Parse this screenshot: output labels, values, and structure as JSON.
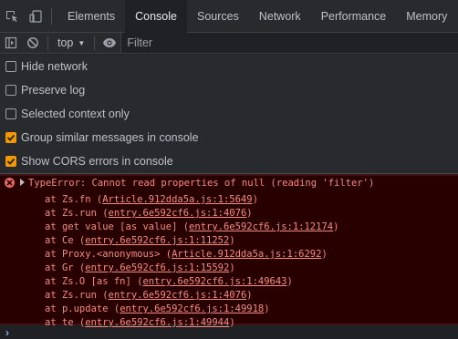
{
  "tabbar": {
    "icons": [
      "inspect-element-icon",
      "device-toolbar-icon"
    ],
    "tabs": [
      {
        "label": "Elements",
        "active": false
      },
      {
        "label": "Console",
        "active": true
      },
      {
        "label": "Sources",
        "active": false
      },
      {
        "label": "Network",
        "active": false
      },
      {
        "label": "Performance",
        "active": false
      },
      {
        "label": "Memory",
        "active": false
      }
    ]
  },
  "toolbar": {
    "icons": [
      "sidebar-toggle-icon",
      "clear-console-icon",
      "eye-icon"
    ],
    "context": "top",
    "filter_placeholder": "Filter"
  },
  "settings": [
    {
      "label": "Hide network",
      "checked": false
    },
    {
      "label": "Preserve log",
      "checked": false
    },
    {
      "label": "Selected context only",
      "checked": false
    },
    {
      "label": "Group similar messages in console",
      "checked": true
    },
    {
      "label": "Show CORS errors in console",
      "checked": true
    }
  ],
  "colors": {
    "checkbox_accent": "#f29900",
    "error_text": "#f28b82",
    "error_bg": "#290000",
    "prompt": "#8ab4f8"
  },
  "error": {
    "message": "TypeError: Cannot read properties of null (reading 'filter')",
    "frames": [
      {
        "prefix": "at Zs.fn (",
        "link": "Article.912dda5a.js:1:5649",
        "suffix": ")"
      },
      {
        "prefix": "at Zs.run (",
        "link": "entry.6e592cf6.js:1:4076",
        "suffix": ")"
      },
      {
        "prefix": "at get value [as value] (",
        "link": "entry.6e592cf6.js:1:12174",
        "suffix": ")"
      },
      {
        "prefix": "at Ce (",
        "link": "entry.6e592cf6.js:1:11252",
        "suffix": ")"
      },
      {
        "prefix": "at Proxy.<anonymous> (",
        "link": "Article.912dda5a.js:1:6292",
        "suffix": ")"
      },
      {
        "prefix": "at Gr (",
        "link": "entry.6e592cf6.js:1:15592",
        "suffix": ")"
      },
      {
        "prefix": "at Zs.O [as fn] (",
        "link": "entry.6e592cf6.js:1:49643",
        "suffix": ")"
      },
      {
        "prefix": "at Zs.run (",
        "link": "entry.6e592cf6.js:1:4076",
        "suffix": ")"
      },
      {
        "prefix": "at p.update (",
        "link": "entry.6e592cf6.js:1:49918",
        "suffix": ")"
      },
      {
        "prefix": "at te (",
        "link": "entry.6e592cf6.js:1:49944",
        "suffix": ")"
      }
    ]
  },
  "prompt": {
    "icon": "prompt-chevron-icon",
    "symbol": "›"
  }
}
